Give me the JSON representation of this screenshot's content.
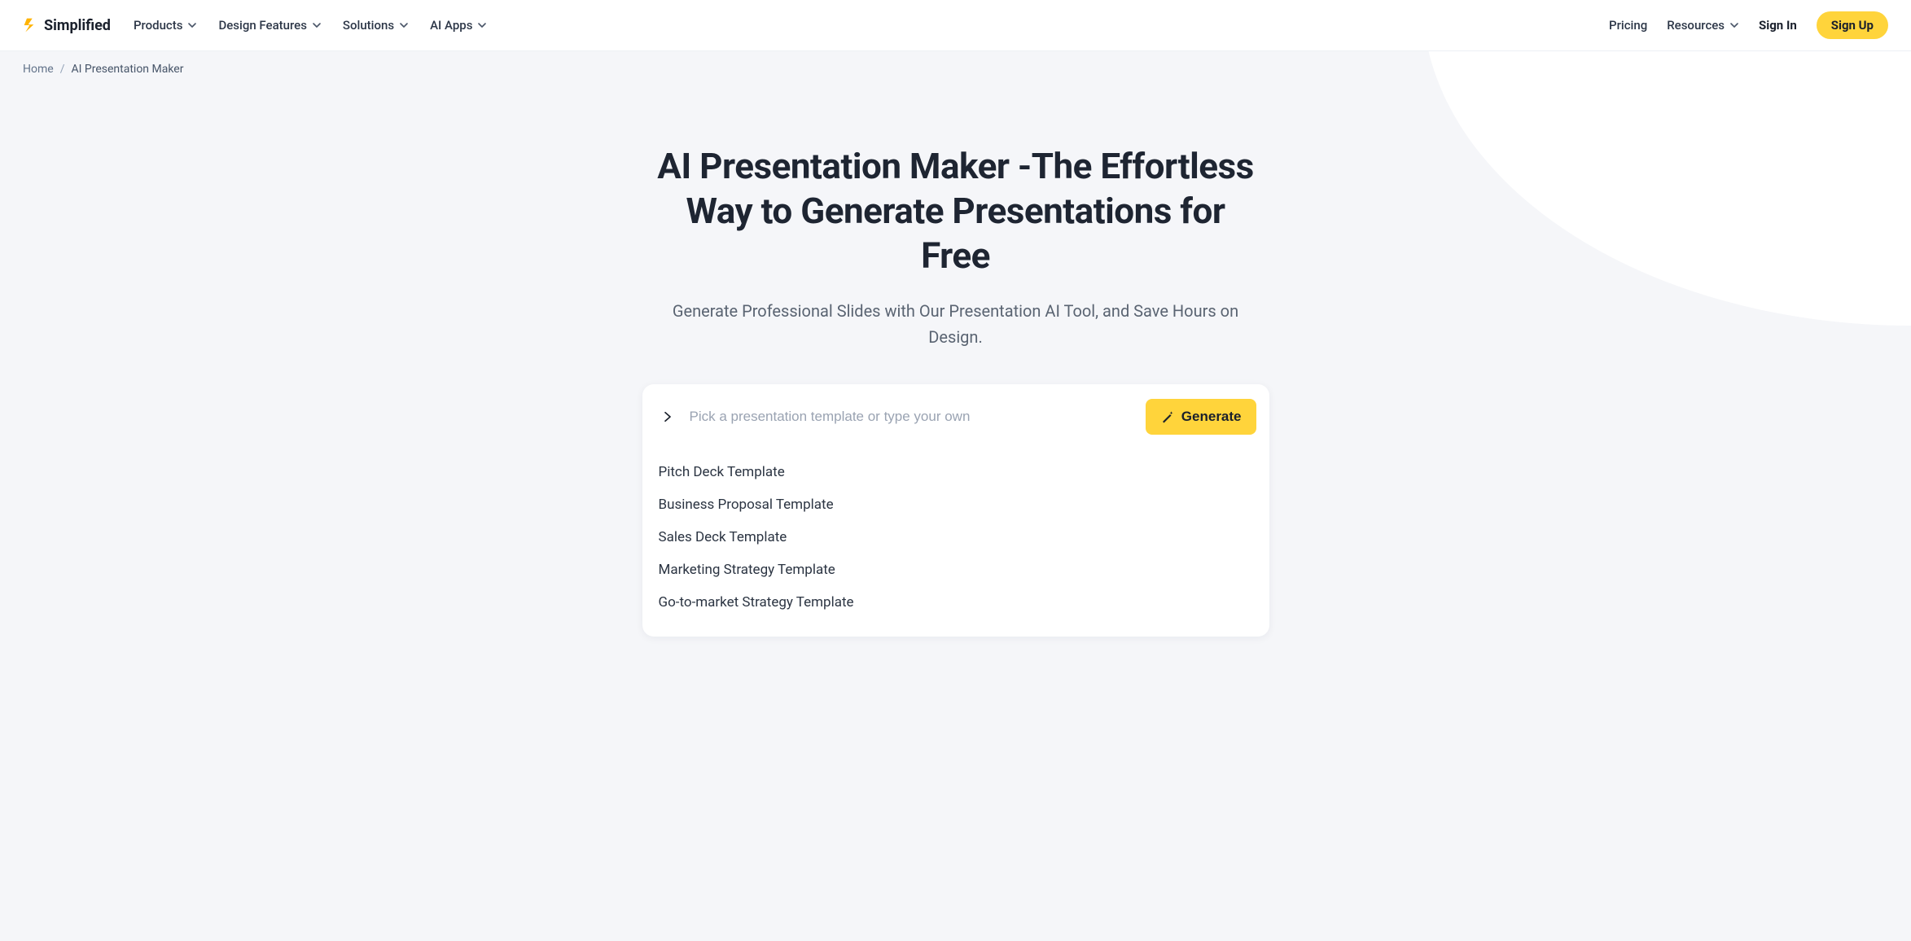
{
  "brand": {
    "name": "Simplified"
  },
  "nav": {
    "items": [
      {
        "label": "Products"
      },
      {
        "label": "Design Features"
      },
      {
        "label": "Solutions"
      },
      {
        "label": "AI Apps"
      }
    ]
  },
  "header_right": {
    "pricing": "Pricing",
    "resources": "Resources",
    "sign_in": "Sign In",
    "sign_up": "Sign Up"
  },
  "breadcrumb": {
    "home": "Home",
    "sep": "/",
    "current": "AI Presentation Maker"
  },
  "hero": {
    "title": "AI Presentation Maker -The Effortless Way to Generate Presentations for Free",
    "subtitle": "Generate Professional Slides with Our Presentation AI Tool, and Save Hours on Design."
  },
  "prompt": {
    "placeholder": "Pick a presentation template or type your own",
    "generate_label": "Generate",
    "templates": [
      "Pitch Deck Template",
      "Business Proposal Template",
      "Sales Deck Template",
      "Marketing Strategy Template",
      "Go-to-market Strategy Template"
    ]
  }
}
